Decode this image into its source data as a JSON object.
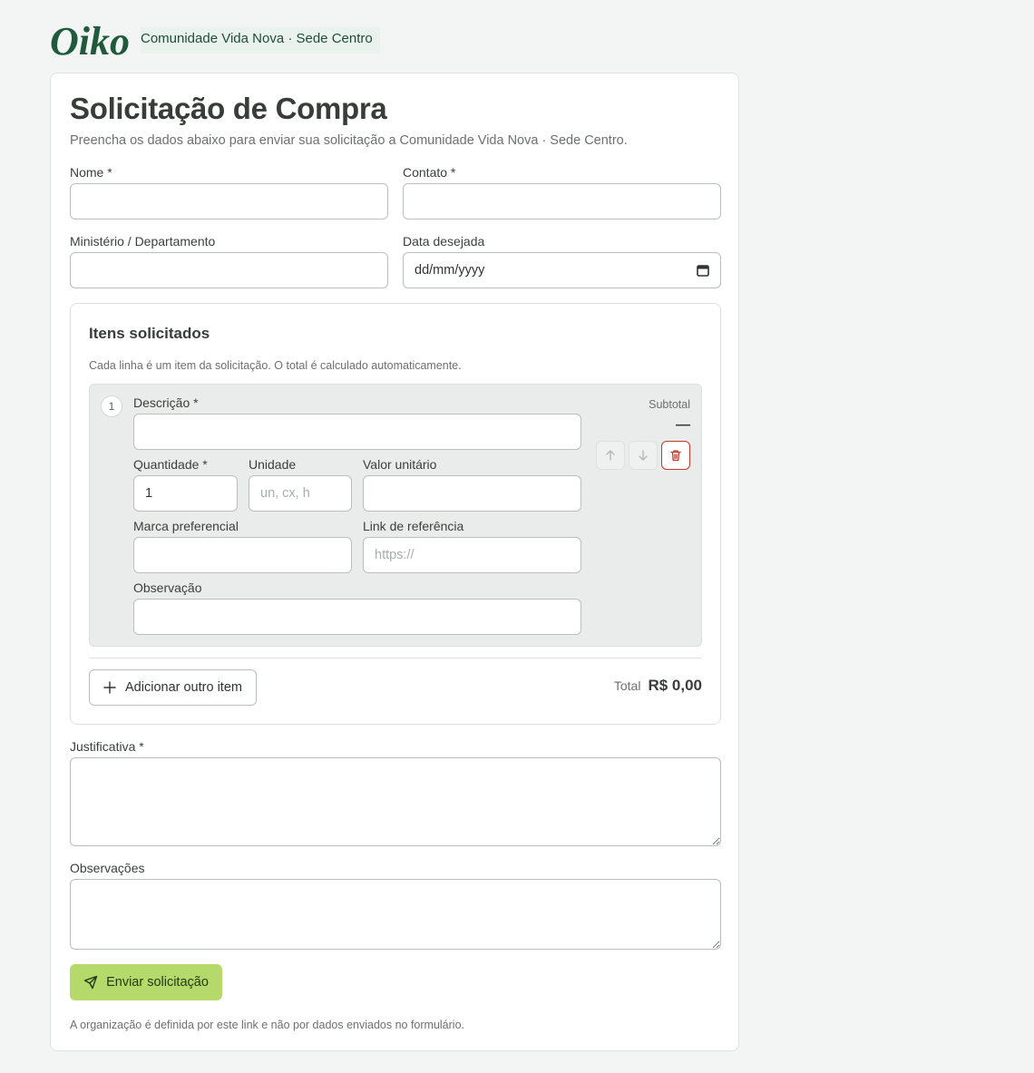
{
  "header": {
    "logo_text": "Oiko",
    "org_name": "Comunidade Vida Nova · Sede Centro"
  },
  "form": {
    "title": "Solicitação de Compra",
    "subtitle": "Preencha os dados abaixo para enviar sua solicitação a Comunidade Vida Nova · Sede Centro.",
    "fields": {
      "nome": {
        "label": "Nome *",
        "value": ""
      },
      "contato": {
        "label": "Contato *",
        "value": ""
      },
      "ministerio": {
        "label": "Ministério / Departamento",
        "value": ""
      },
      "data": {
        "label": "Data desejada",
        "value": "dd/mm/yyyy"
      }
    },
    "items_section": {
      "title": "Itens solicitados",
      "subtitle": "Cada linha é um item da solicitação. O total é calculado automaticamente.",
      "items": [
        {
          "number": "1",
          "descricao_label": "Descrição *",
          "descricao_value": "",
          "quantidade_label": "Quantidade *",
          "quantidade_value": "1",
          "unidade_label": "Unidade",
          "unidade_placeholder": "un, cx, h",
          "valor_label": "Valor unitário",
          "valor_value": "",
          "marca_label": "Marca preferencial",
          "marca_value": "",
          "link_label": "Link de referência",
          "link_placeholder": "https://",
          "observacao_label": "Observação",
          "observacao_value": "",
          "subtotal_label": "Subtotal",
          "subtotal_value": "—"
        }
      ],
      "add_item_label": "Adicionar outro item",
      "total_label": "Total",
      "total_value": "R$ 0,00"
    },
    "justificativa": {
      "label": "Justificativa *",
      "value": ""
    },
    "observacoes": {
      "label": "Observações",
      "value": ""
    },
    "submit_label": "Enviar solicitação",
    "footer_note": "A organização é definida por este link e não por dados enviados no formulário."
  },
  "colors": {
    "brand_green": "#1f5a3c",
    "submit_green": "#b6d96b",
    "delete_red": "#c0392b",
    "page_background": "#f2f5f4"
  }
}
